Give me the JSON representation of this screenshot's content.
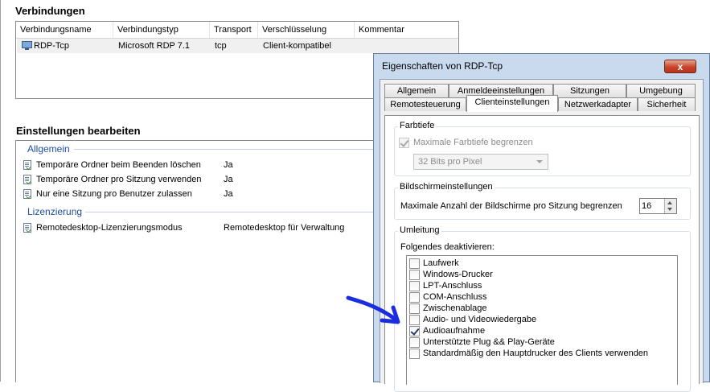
{
  "connections": {
    "title": "Verbindungen",
    "columns": [
      "Verbindungsname",
      "Verbindungstyp",
      "Transport",
      "Verschlüsselung",
      "Kommentar"
    ],
    "row": {
      "name": "RDP-Tcp",
      "type": "Microsoft RDP 7.1",
      "transport": "tcp",
      "encryption": "Client-kompatibel",
      "comment": ""
    }
  },
  "settings": {
    "title": "Einstellungen bearbeiten",
    "groups": [
      {
        "label": "Allgemein",
        "items": [
          {
            "name": "Temporäre Ordner beim Beenden löschen",
            "value": "Ja"
          },
          {
            "name": "Temporäre Ordner pro Sitzung verwenden",
            "value": "Ja"
          },
          {
            "name": "Nur eine Sitzung pro Benutzer zulassen",
            "value": "Ja"
          }
        ]
      },
      {
        "label": "Lizenzierung",
        "items": [
          {
            "name": "Remotedesktop-Lizenzierungsmodus",
            "value": "Remotedesktop für Verwaltung"
          }
        ]
      }
    ]
  },
  "dialog": {
    "title": "Eigenschaften von RDP-Tcp",
    "close_label": "x",
    "tabs_row1": [
      "Allgemein",
      "Anmeldeeinstellungen",
      "Sitzungen",
      "Umgebung"
    ],
    "tabs_row2": [
      "Remotesteuerung",
      "Clienteinstellungen",
      "Netzwerkadapter",
      "Sicherheit"
    ],
    "active_tab": "Clienteinstellungen",
    "color_depth": {
      "title": "Farbtiefe",
      "limit_label": "Maximale Farbtiefe begrenzen",
      "limit_checked": true,
      "limit_enabled": false,
      "selected_depth": "32 Bits pro Pixel"
    },
    "monitor": {
      "title": "Bildschirmeinstellungen",
      "limit_label": "Maximale Anzahl der Bildschirme pro Sitzung begrenzen",
      "value": "16"
    },
    "redirection": {
      "title": "Umleitung",
      "subtitle": "Folgendes deaktivieren:",
      "items": [
        {
          "label": "Laufwerk",
          "checked": false
        },
        {
          "label": "Windows-Drucker",
          "checked": false
        },
        {
          "label": "LPT-Anschluss",
          "checked": false
        },
        {
          "label": "COM-Anschluss",
          "checked": false
        },
        {
          "label": "Zwischenablage",
          "checked": false
        },
        {
          "label": "Audio- und Videowiedergabe",
          "checked": false
        },
        {
          "label": "Audioaufnahme",
          "checked": true
        },
        {
          "label": "Unterstützte Plug && Play-Geräte",
          "checked": false
        },
        {
          "label": "Standardmäßig den Hauptdrucker des Clients verwenden",
          "checked": false
        }
      ]
    }
  },
  "colors": {
    "accent_blue": "#1e4fa3",
    "arrow_blue": "#1a2ee0",
    "title_bar": "#c9d9ee"
  }
}
